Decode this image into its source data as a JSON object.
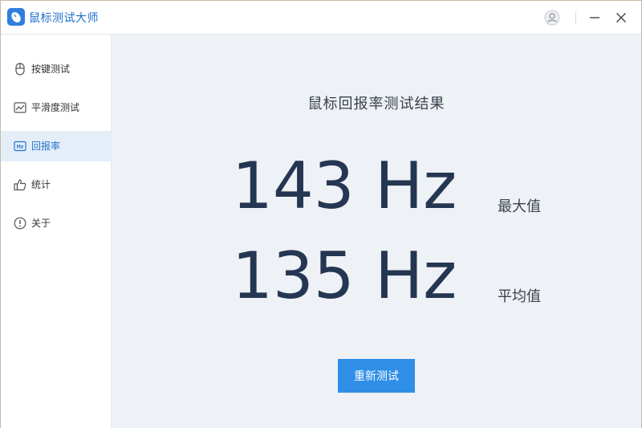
{
  "app": {
    "title": "鼠标测试大师",
    "accent_color": "#2f8ee6",
    "brand_color": "#1f6fd0"
  },
  "window_controls": {
    "user_icon": "user-icon",
    "minimize_icon": "minimize-icon",
    "close_icon": "close-icon"
  },
  "sidebar": {
    "items": [
      {
        "label": "按键测试",
        "icon": "mouse-icon",
        "active": false
      },
      {
        "label": "平滑度测试",
        "icon": "line-chart-icon",
        "active": false
      },
      {
        "label": "回报率",
        "icon": "hz-icon",
        "active": true
      },
      {
        "label": "统计",
        "icon": "thumbs-up-icon",
        "active": false
      },
      {
        "label": "关于",
        "icon": "info-icon",
        "active": false
      }
    ]
  },
  "main": {
    "title": "鼠标回报率测试结果",
    "max_value": "143 Hz",
    "max_label": "最大值",
    "avg_value": "135 Hz",
    "avg_label": "平均值",
    "retest_label": "重新测试"
  }
}
